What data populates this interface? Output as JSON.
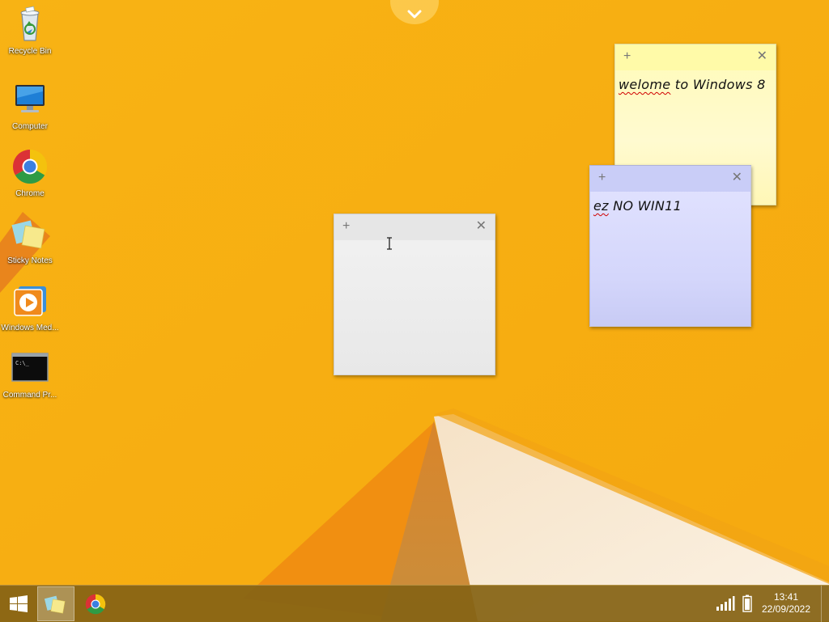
{
  "desktop": {
    "icons": [
      {
        "label": "Recycle Bin",
        "icon": "recycle-bin-icon"
      },
      {
        "label": "Computer",
        "icon": "computer-icon"
      },
      {
        "label": "Chrome",
        "icon": "chrome-icon"
      },
      {
        "label": "Sticky Notes",
        "icon": "sticky-notes-icon"
      },
      {
        "label": "Windows Med...",
        "icon": "windows-media-player-icon"
      },
      {
        "label": "Command Pr...",
        "icon": "command-prompt-icon"
      }
    ]
  },
  "notes": [
    {
      "color": "#fffbb8",
      "text_pre": "",
      "text_err": "welome",
      "text_post": " to Windows 8",
      "add_symbol": "+",
      "close_symbol": "✕"
    },
    {
      "color": "#ececec",
      "text_pre": "",
      "text_err": "",
      "text_post": "",
      "add_symbol": "+",
      "close_symbol": "✕"
    },
    {
      "color": "#d6d8fb",
      "text_pre": "",
      "text_err": "ez",
      "text_post": " NO WIN11",
      "add_symbol": "+",
      "close_symbol": "✕"
    }
  ],
  "taskbar": {
    "start_icon": "windows-logo-icon",
    "pinned": [
      {
        "icon": "sticky-notes-icon",
        "active": true
      },
      {
        "icon": "chrome-icon",
        "active": false
      }
    ],
    "tray": {
      "signal_icon": "signal-icon",
      "battery_icon": "battery-icon",
      "time": "13:41",
      "date": "22/09/2022"
    }
  },
  "colors": {
    "wallpaper": "#f7b013",
    "taskbar": "#856314"
  }
}
